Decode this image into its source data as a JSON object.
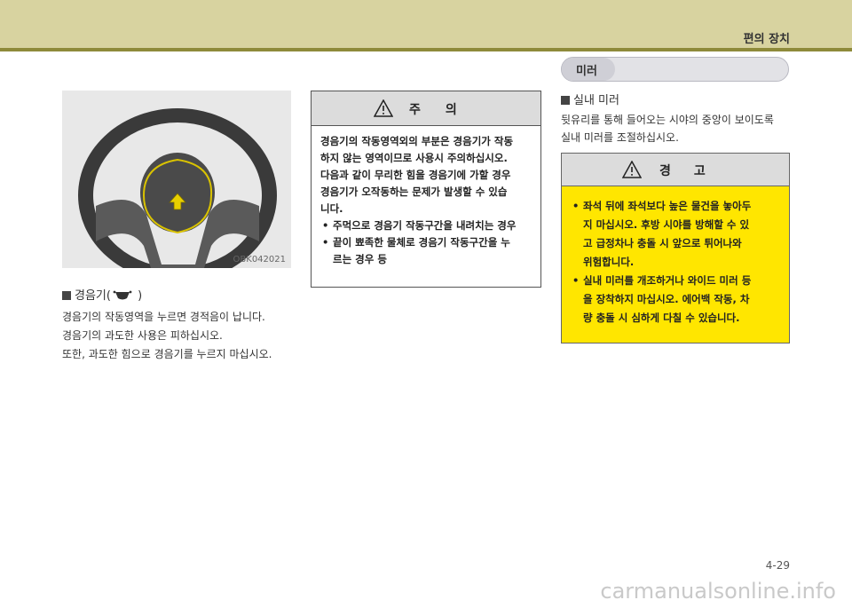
{
  "header": {
    "section_title": "편의 장치"
  },
  "figure": {
    "code": "OBK042021"
  },
  "horn": {
    "heading_prefix": "경음기(",
    "heading_suffix": " )",
    "lines": [
      "경음기의 작동영역을 누르면 경적음이 납니다.",
      "경음기의 과도한 사용은 피하십시오.",
      "또한, 과도한 힘으로 경음기를 누르지 마십시오."
    ],
    "horn_icon": "horn-icon"
  },
  "caution": {
    "title": "주의",
    "lines": [
      "경음기의 작동영역외의 부분은 경음기가 작동",
      "하지 않는 영역이므로 사용시 주의하십시오.",
      "다음과 같이 무리한 힘을 경음기에 가할 경우",
      "경음기가 오작동하는 문제가 발생할 수 있습",
      "니다."
    ],
    "bullets": [
      [
        "주먹으로 경음기 작동구간을 내려치는 경우"
      ],
      [
        "끝이 뾰족한 물체로 경음기 작동구간을 누",
        "르는 경우 등"
      ]
    ]
  },
  "mirror": {
    "pill_label": "미러",
    "sub_heading": "실내 미러",
    "lines": [
      "뒷유리를 통해 들어오는 시야의 중앙이 보이도록",
      "실내 미러를 조절하십시오."
    ]
  },
  "warning": {
    "title": "경고",
    "bullets": [
      [
        "좌석 뒤에 좌석보다 높은 물건을 놓아두",
        "지 마십시오. 후방 시야를 방해할 수 있",
        "고 급정차나 충돌 시 앞으로 튀어나와",
        "위험합니다."
      ],
      [
        "실내 미러를 개조하거나 와이드 미러 등",
        "을 장착하지 마십시오. 에어백 작동, 차",
        "량 충돌 시 심하게 다칠 수 있습니다."
      ]
    ],
    "bg_color": "#ffe600"
  },
  "footer": {
    "page_number": "4-29",
    "watermark": "carmanualsonline.info"
  }
}
